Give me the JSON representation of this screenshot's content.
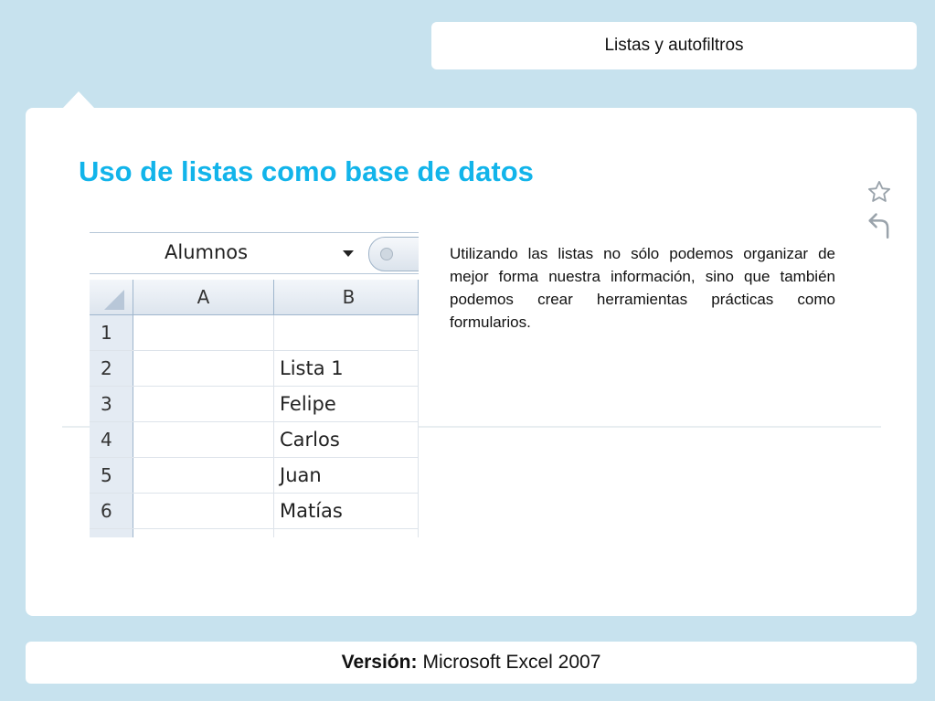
{
  "header": {
    "title": "Listas y autofiltros"
  },
  "slide": {
    "heading": "Uso de listas como base de datos",
    "description": "Utilizando las listas no sólo podemos organizar de mejor forma nuestra información, sino que también podemos crear herramientas prácticas como formularios.",
    "accent_color": "#12b4ea",
    "icons": [
      "star-icon",
      "undo-icon"
    ]
  },
  "spreadsheet": {
    "name_box_value": "Alumnos",
    "columns": [
      "A",
      "B"
    ],
    "rows": [
      {
        "num": "1",
        "a": "",
        "b": ""
      },
      {
        "num": "2",
        "a": "",
        "b": "Lista 1"
      },
      {
        "num": "3",
        "a": "",
        "b": "Felipe"
      },
      {
        "num": "4",
        "a": "",
        "b": "Carlos"
      },
      {
        "num": "5",
        "a": "",
        "b": "Juan"
      },
      {
        "num": "6",
        "a": "",
        "b": "Matías"
      },
      {
        "num": "",
        "a": "",
        "b": ""
      }
    ]
  },
  "footer": {
    "label": "Versión:",
    "value": "Microsoft Excel 2007"
  }
}
